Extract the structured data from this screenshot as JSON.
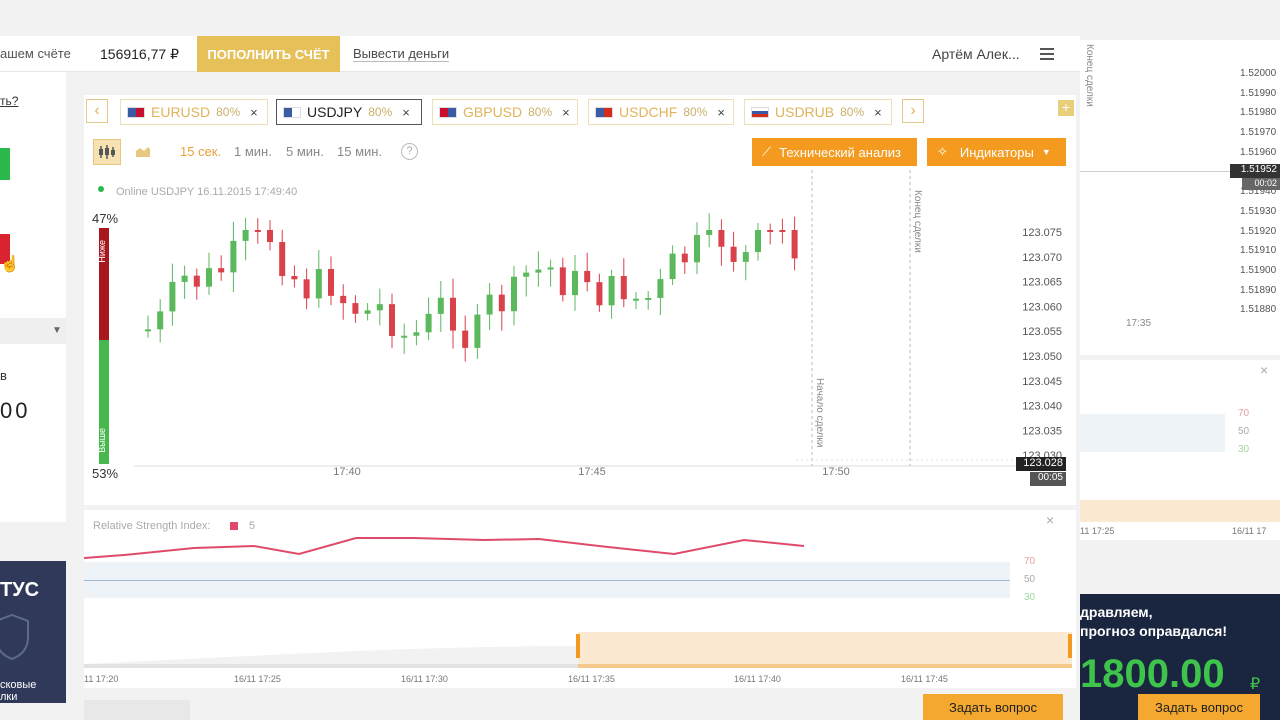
{
  "topbar": {
    "account_label": "ашем счёте",
    "balance": "156916,77 ₽",
    "deposit_button": "ПОПОЛНИТЬ СЧЁТ",
    "withdraw_link": "Вывести деньги",
    "user_name": "Артём Алек..."
  },
  "left": {
    "question": "ть?",
    "v_label": "в",
    "amount": "00",
    "status_title": "ТУС",
    "status_sub1": "сковые",
    "status_sub2": "лки"
  },
  "tabs": [
    {
      "symbol": "EURUSD",
      "pct": "80%",
      "flag_colors": [
        "#3b5ba5",
        "#c8102e"
      ]
    },
    {
      "symbol": "USDJPY",
      "pct": "80%",
      "flag_colors": [
        "#3b5ba5",
        "#c8102e"
      ]
    },
    {
      "symbol": "GBPUSD",
      "pct": "80%",
      "flag_colors": [
        "#c8102e",
        "#3b5ba5"
      ]
    },
    {
      "symbol": "USDCHF",
      "pct": "80%",
      "flag_colors": [
        "#3b5ba5",
        "#d52b1e"
      ]
    },
    {
      "symbol": "USDRUB",
      "pct": "80%",
      "flag_colors": [
        "#3b5ba5",
        "#d52b1e"
      ]
    }
  ],
  "toolbar": {
    "timeframes": [
      "15 сек.",
      "1 мин.",
      "5 мин.",
      "15 мин."
    ],
    "help": "?",
    "tech_analysis": "Технический анализ",
    "indicators": "Индикаторы"
  },
  "chart": {
    "online_label": "Online USDJPY 16.11.2015 17:49:40",
    "top_pct": "47%",
    "bottom_pct": "53%",
    "lower_label": "Ниже",
    "higher_label": "Выше",
    "deal_end": "Конец сделки",
    "deal_start": "Начало сделки",
    "current_price": "123.028",
    "current_time": "00:05",
    "colors": {
      "up": "#5cb85c",
      "down": "#d9414b",
      "accent": "#f39a1f"
    }
  },
  "chart_data": {
    "type": "candlestick",
    "y_ticks": [
      "123.075",
      "123.070",
      "123.065",
      "123.060",
      "123.055",
      "123.050",
      "123.045",
      "123.040",
      "123.035",
      "123.030"
    ],
    "x_ticks": [
      "17:40",
      "17:45",
      "17:50"
    ],
    "ylim": [
      123.028,
      123.078
    ]
  },
  "rsi": {
    "title": "Relative Strength Index:",
    "period": "5",
    "levels": [
      "70",
      "50",
      "30"
    ]
  },
  "timeline": {
    "labels": [
      "11 17:20",
      "16/11 17:25",
      "16/11 17:30",
      "16/11 17:35",
      "16/11 17:40",
      "16/11 17:45"
    ]
  },
  "right": {
    "deal_end": "Конец сделки",
    "prices": [
      "1.52000",
      "1.51990",
      "1.51980",
      "1.51970",
      "1.51960",
      "1.51952",
      "1.51940",
      "1.51930",
      "1.51920",
      "1.51910",
      "1.51900",
      "1.51890",
      "1.51880"
    ],
    "current_time": "00:02",
    "time_label": "17:35",
    "rsi_levels": [
      "70",
      "50",
      "30"
    ],
    "timeline": [
      "11 17:25",
      "16/11 17"
    ],
    "congrats1": "дравляем,",
    "congrats2": "прогноз оправдался!",
    "win_amount": "1800.00",
    "currency": "₽"
  },
  "ask_button": "Задать вопрос"
}
